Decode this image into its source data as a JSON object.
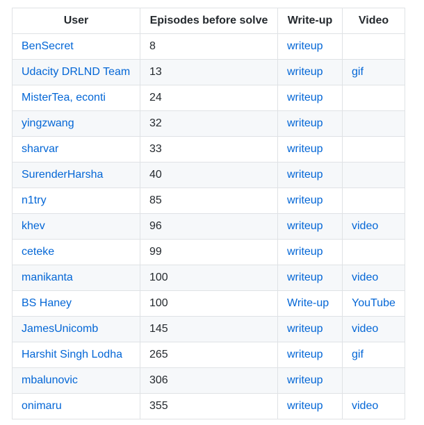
{
  "table": {
    "headers": {
      "user": "User",
      "episodes": "Episodes before solve",
      "writeup": "Write-up",
      "video": "Video"
    },
    "rows": [
      {
        "user": "BenSecret",
        "episodes": "8",
        "writeup": "writeup",
        "video": ""
      },
      {
        "user": "Udacity DRLND Team",
        "episodes": "13",
        "writeup": "writeup",
        "video": "gif"
      },
      {
        "user": "MisterTea, econti",
        "episodes": "24",
        "writeup": "writeup",
        "video": ""
      },
      {
        "user": "yingzwang",
        "episodes": "32",
        "writeup": "writeup",
        "video": ""
      },
      {
        "user": "sharvar",
        "episodes": "33",
        "writeup": "writeup",
        "video": ""
      },
      {
        "user": "SurenderHarsha",
        "episodes": "40",
        "writeup": "writeup",
        "video": ""
      },
      {
        "user": "n1try",
        "episodes": "85",
        "writeup": "writeup",
        "video": ""
      },
      {
        "user": "khev",
        "episodes": "96",
        "writeup": "writeup",
        "video": "video"
      },
      {
        "user": "ceteke",
        "episodes": "99",
        "writeup": "writeup",
        "video": ""
      },
      {
        "user": "manikanta",
        "episodes": "100",
        "writeup": "writeup",
        "video": "video"
      },
      {
        "user": "BS Haney",
        "episodes": "100",
        "writeup": "Write-up",
        "video": "YouTube"
      },
      {
        "user": "JamesUnicomb",
        "episodes": "145",
        "writeup": "writeup",
        "video": "video"
      },
      {
        "user": "Harshit Singh Lodha",
        "episodes": "265",
        "writeup": "writeup",
        "video": "gif"
      },
      {
        "user": "mbalunovic",
        "episodes": "306",
        "writeup": "writeup",
        "video": ""
      },
      {
        "user": "onimaru",
        "episodes": "355",
        "writeup": "writeup",
        "video": "video"
      }
    ]
  },
  "colors": {
    "link": "#0366d6",
    "text": "#24292e",
    "border": "#dfe2e5",
    "stripe": "#f6f8fa"
  }
}
